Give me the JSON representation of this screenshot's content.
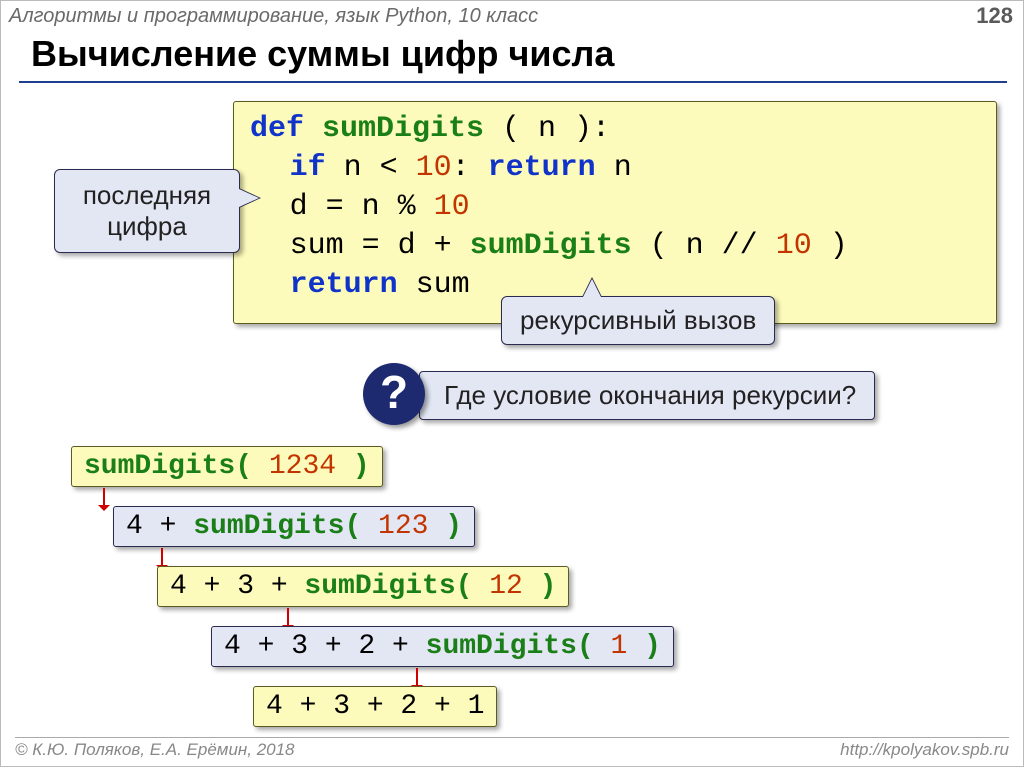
{
  "header": {
    "subject": "Алгоритмы и программирование, язык Python, 10 класс",
    "page": "128"
  },
  "title": "Вычисление суммы цифр числа",
  "code": {
    "l1a": "def ",
    "l1b": "sumDigits ",
    "l1c": "( n ):",
    "l2a": "if",
    "l2b": " n < ",
    "l2c": "10",
    "l2d": ": ",
    "l2e": "return",
    "l2f": " n",
    "l3a": "d = n % ",
    "l3b": "10",
    "l4a": "sum = d + ",
    "l4b": "sumDigits ",
    "l4c": "( n // ",
    "l4d": "10",
    "l4e": " )",
    "l5a": "return",
    "l5b": " sum"
  },
  "callouts": {
    "last_digit": "последняя цифра",
    "recursive_call": "рекурсивный вызов"
  },
  "question": {
    "mark": "?",
    "text": "Где условие окончания рекурсии?"
  },
  "trace": {
    "r1_fn": "sumDigits(",
    "r1_arg": " 1234 ",
    "r1_close": ")",
    "r2_pre": "4 + ",
    "r2_fn": "sumDigits(",
    "r2_arg": " 123 ",
    "r2_close": ")",
    "r3_pre": "4 + 3 + ",
    "r3_fn": "sumDigits(",
    "r3_arg": " 12 ",
    "r3_close": ")",
    "r4_pre": "4 + 3 + 2 + ",
    "r4_fn": "sumDigits(",
    "r4_arg": " 1 ",
    "r4_close": ")",
    "r5": "4 + 3 + 2 + 1"
  },
  "footer": {
    "left": "© К.Ю. Поляков, Е.А. Ерёмин, 2018",
    "right": "http://kpolyakov.spb.ru"
  }
}
